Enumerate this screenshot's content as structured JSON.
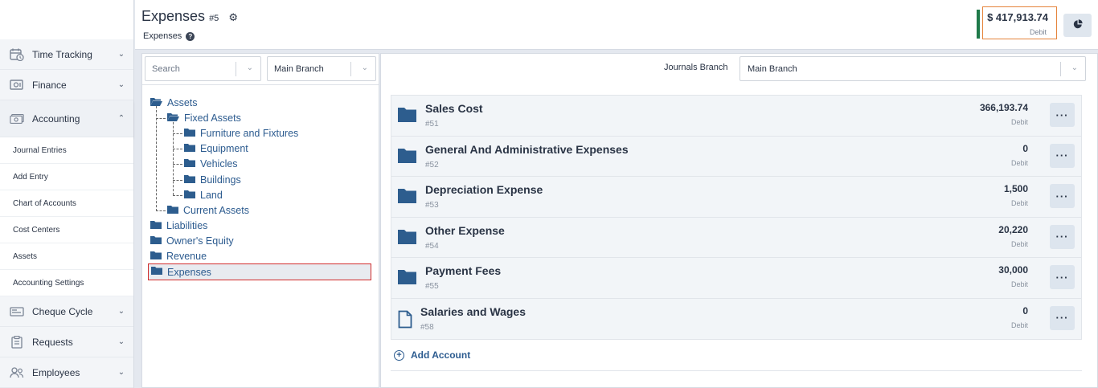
{
  "sidebar": {
    "items": [
      {
        "label": "Time Tracking",
        "icon": "calendar-clock-icon"
      },
      {
        "label": "Finance",
        "icon": "safe-icon"
      },
      {
        "label": "Accounting",
        "icon": "money-icon",
        "open": true
      }
    ],
    "accounting_sub": [
      {
        "label": "Journal Entries"
      },
      {
        "label": "Add Entry"
      },
      {
        "label": "Chart of Accounts"
      },
      {
        "label": "Cost Centers"
      },
      {
        "label": "Assets"
      },
      {
        "label": "Accounting Settings"
      }
    ],
    "items_after": [
      {
        "label": "Cheque Cycle",
        "icon": "cheque-icon"
      },
      {
        "label": "Requests",
        "icon": "clipboard-icon"
      },
      {
        "label": "Employees",
        "icon": "users-icon"
      }
    ]
  },
  "header": {
    "title": "Expenses",
    "number": "#5",
    "subtitle": "Expenses",
    "balance": "$ 417,913.74",
    "balance_type": "Debit",
    "balance_bar_color": "#1f7a4a",
    "balance_border_color": "#e5833a"
  },
  "left_panel": {
    "search_placeholder": "Search",
    "branch": "Main Branch"
  },
  "tree": {
    "assets": "Assets",
    "fixed_assets": "Fixed Assets",
    "furniture": "Furniture and Fixtures",
    "equipment": "Equipment",
    "vehicles": "Vehicles",
    "buildings": "Buildings",
    "land": "Land",
    "current_assets": "Current Assets",
    "liabilities": "Liabilities",
    "owners_equity": "Owner's Equity",
    "revenue": "Revenue",
    "expenses": "Expenses"
  },
  "right_panel": {
    "journals_branch_label": "Journals Branch",
    "journals_branch_value": "Main Branch",
    "accounts": [
      {
        "name": "Sales Cost",
        "code": "#51",
        "value": "366,193.74",
        "type": "Debit",
        "icon": "folder-icon"
      },
      {
        "name": "General And Administrative Expenses",
        "code": "#52",
        "value": "0",
        "type": "Debit",
        "icon": "folder-icon"
      },
      {
        "name": "Depreciation Expense",
        "code": "#53",
        "value": "1,500",
        "type": "Debit",
        "icon": "folder-icon"
      },
      {
        "name": "Other Expense",
        "code": "#54",
        "value": "20,220",
        "type": "Debit",
        "icon": "folder-icon"
      },
      {
        "name": "Payment Fees",
        "code": "#55",
        "value": "30,000",
        "type": "Debit",
        "icon": "folder-icon"
      },
      {
        "name": "Salaries and Wages",
        "code": "#58",
        "value": "0",
        "type": "Debit",
        "icon": "file-icon"
      }
    ],
    "add_account_label": "Add Account",
    "more_label": "···"
  },
  "colors": {
    "link": "#2c5b8f",
    "folder": "#2d5d8e"
  }
}
